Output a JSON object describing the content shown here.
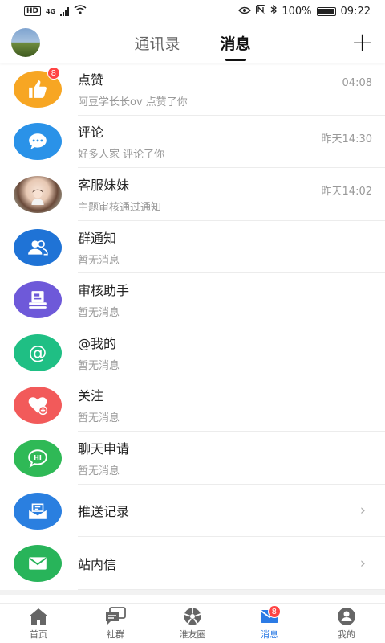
{
  "status_bar": {
    "hd": "HD",
    "network": "4G",
    "battery": "100%",
    "time": "09:22"
  },
  "header": {
    "tabs": [
      {
        "label": "通讯录",
        "active": false
      },
      {
        "label": "消息",
        "active": true
      }
    ],
    "add_icon": "plus-icon"
  },
  "messages": [
    {
      "title": "点赞",
      "subtitle": "阿豆学长长ov 点赞了你",
      "time": "04:08",
      "badge": "8",
      "icon": "thumbs-up-icon",
      "color": "#f7a623"
    },
    {
      "title": "评论",
      "subtitle": "好多人家 评论了你",
      "time": "昨天14:30",
      "icon": "comment-icon",
      "color": "#2a92e8"
    },
    {
      "title": "客服妹妹",
      "subtitle": "主题审核通过通知",
      "time": "昨天14:02",
      "icon": "avatar-photo",
      "color": "#e9d7c8"
    },
    {
      "title": "群通知",
      "subtitle": "暂无消息",
      "icon": "group-icon",
      "color": "#1f73d6"
    },
    {
      "title": "审核助手",
      "subtitle": "暂无消息",
      "icon": "review-icon",
      "color": "#6e59d9"
    },
    {
      "title": "@我的",
      "subtitle": "暂无消息",
      "icon": "at-icon",
      "color": "#1fbf84"
    },
    {
      "title": "关注",
      "subtitle": "暂无消息",
      "icon": "heart-plus-icon",
      "color": "#f25a5a"
    },
    {
      "title": "聊天申请",
      "subtitle": "暂无消息",
      "icon": "chat-hi-icon",
      "color": "#2fb956"
    }
  ],
  "links": [
    {
      "title": "推送记录",
      "icon": "push-record-icon",
      "color": "#2a7fe0"
    },
    {
      "title": "站内信",
      "icon": "mail-icon",
      "color": "#28b45a"
    }
  ],
  "tabbar": [
    {
      "label": "首页",
      "icon": "home-icon"
    },
    {
      "label": "社群",
      "icon": "community-icon"
    },
    {
      "label": "淮友圈",
      "icon": "moments-icon"
    },
    {
      "label": "消息",
      "icon": "message-icon",
      "active": true,
      "badge": "8"
    },
    {
      "label": "我的",
      "icon": "profile-icon"
    }
  ]
}
